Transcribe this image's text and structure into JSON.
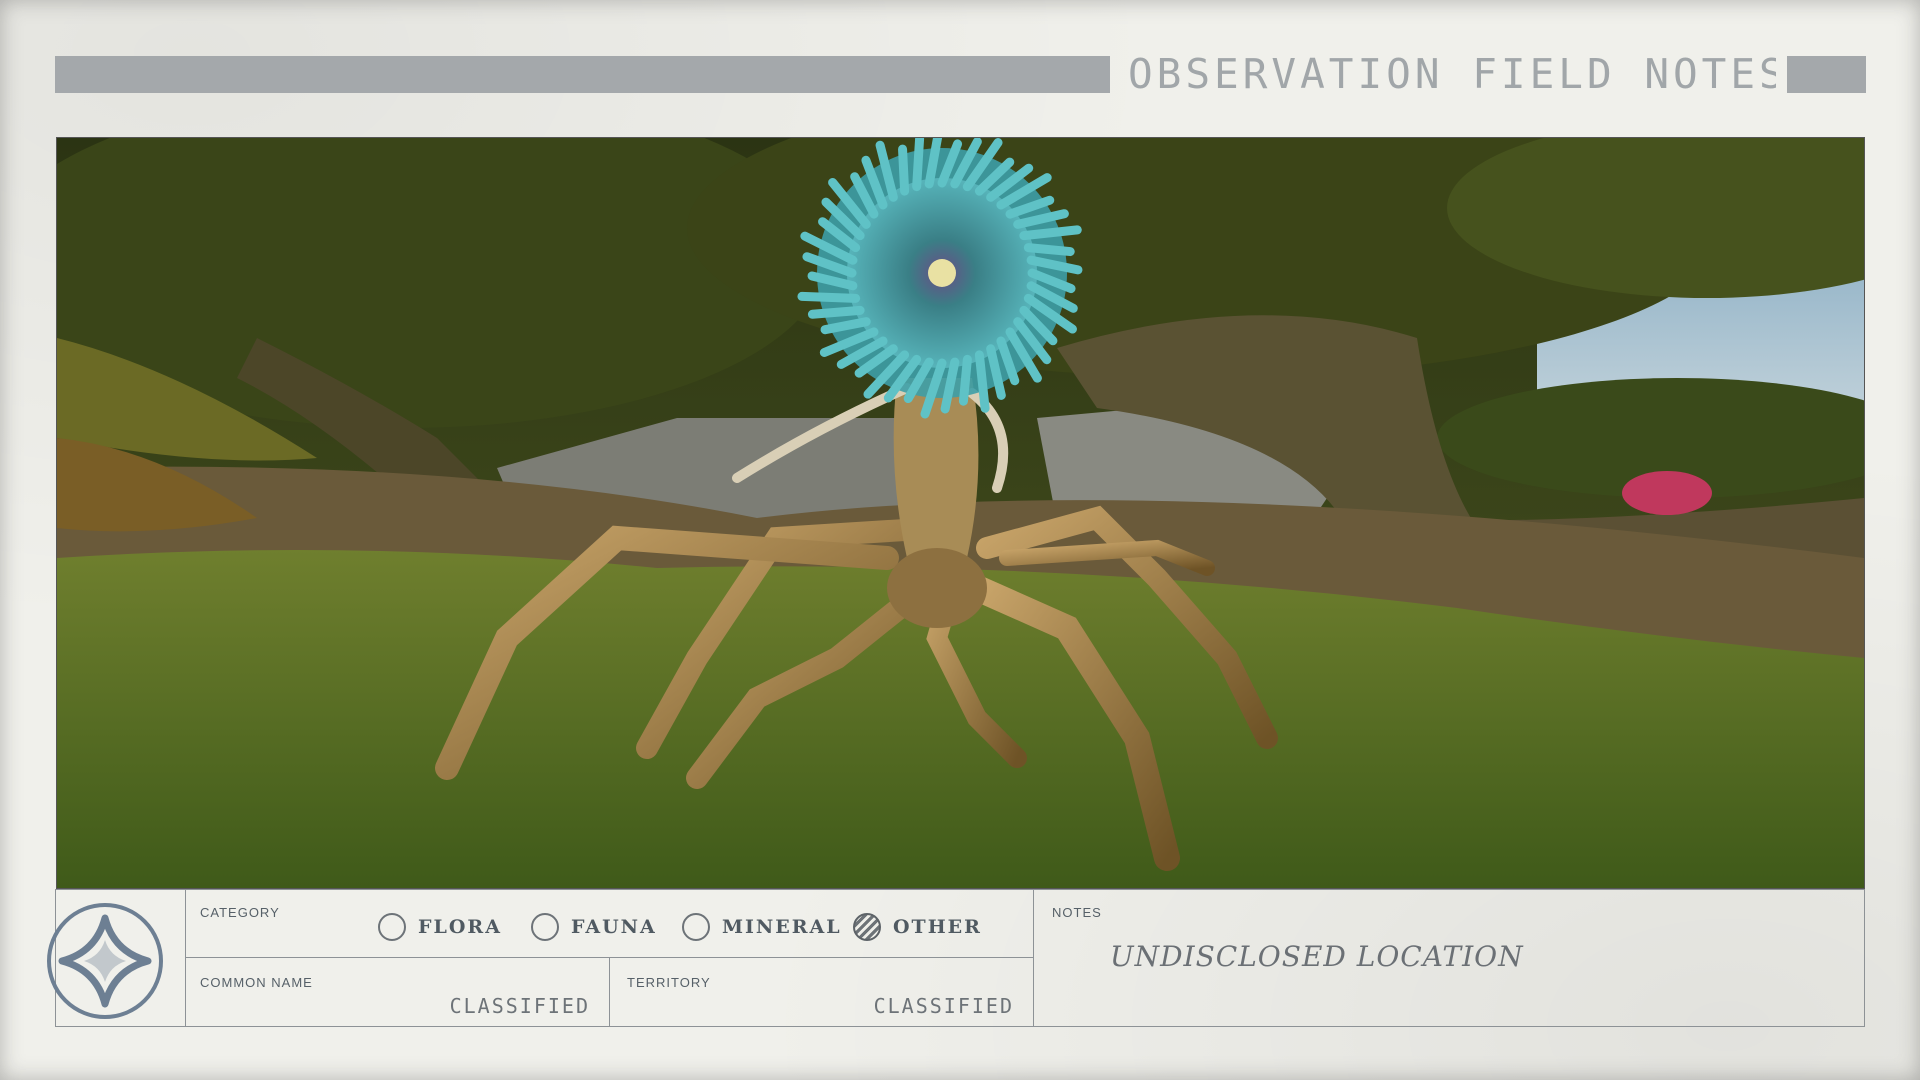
{
  "header": {
    "title": "OBSERVATION FIELD NOTES"
  },
  "photo": {
    "subject_icon": "alien-creature-photo"
  },
  "form": {
    "category_label": "CATEGORY",
    "options": [
      {
        "label": "FLORA",
        "selected": false
      },
      {
        "label": "FAUNA",
        "selected": false
      },
      {
        "label": "MINERAL",
        "selected": false
      },
      {
        "label": "OTHER",
        "selected": true
      }
    ],
    "common_name_label": "COMMON NAME",
    "common_name_value": "CLASSIFIED",
    "territory_label": "TERRITORY",
    "territory_value": "CLASSIFIED",
    "notes_label": "NOTES",
    "notes_value": "UNDISCLOSED LOCATION",
    "emblem_icon": "star-emblem-icon"
  },
  "colors": {
    "paper": "#f0f0eb",
    "bar": "#a4a8ab",
    "ink": "#505a62"
  }
}
